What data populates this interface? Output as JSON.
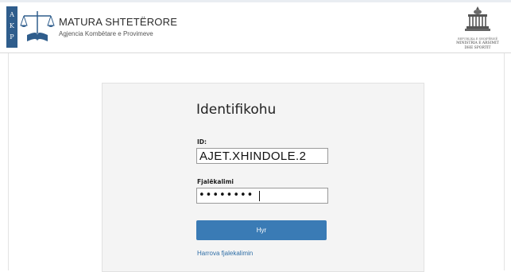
{
  "header": {
    "title": "MATURA SHTETËRORE",
    "subtitle": "Agjencia Kombëtare e Provimeve",
    "logo_letters": [
      "A",
      "K",
      "P"
    ],
    "logo_icon": "scales-book-logo-icon",
    "ministry": {
      "seal_icon": "government-building-seal-icon",
      "line1": "REPUBLIKA E SHQIPËRISË",
      "line2": "MINISTRIA E ARSIMIT",
      "line3": "DHE SPORTIT"
    }
  },
  "login": {
    "title": "Identifikohu",
    "id_label": "ID:",
    "id_value": "AJET.XHINDOLE.2",
    "password_label": "Fjalëkalimi",
    "password_value": "••••••••",
    "submit_label": "Hyr",
    "forgot_link": "Harrova fjalekalimin"
  },
  "colors": {
    "accent": "#3a7bb5",
    "link": "#2f6ea6",
    "logo_blue": "#2f5d8c",
    "panel_bg": "#f4f4f4"
  }
}
